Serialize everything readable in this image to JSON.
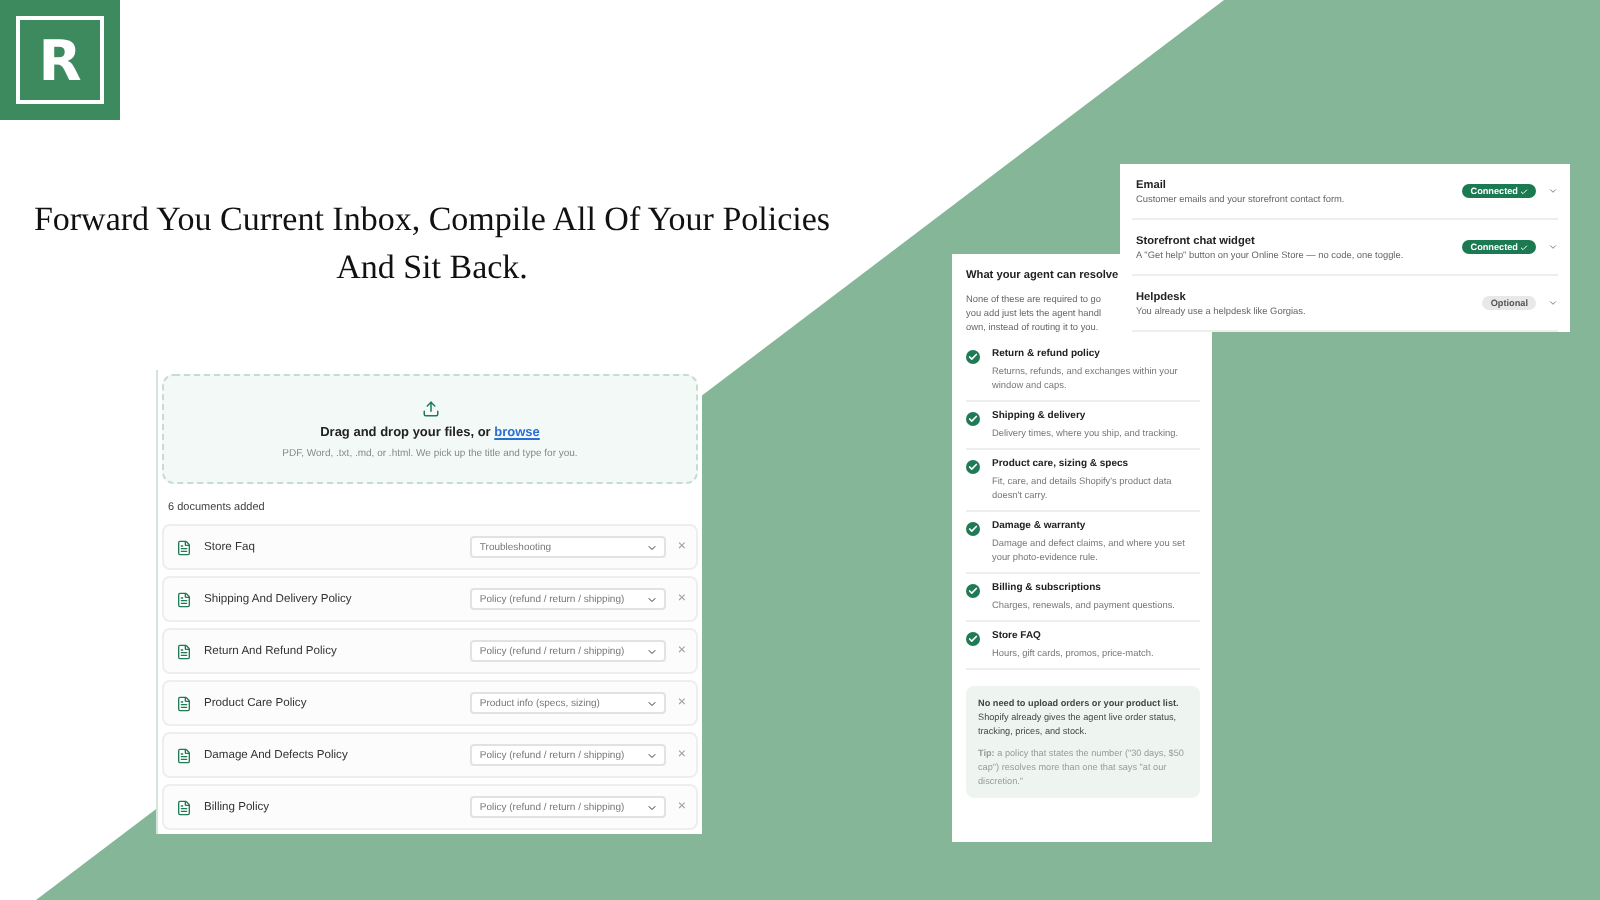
{
  "logo": {
    "letter": "R"
  },
  "headline": [
    "Forward You Current Inbox, Compile All Of Your Policies",
    "And Sit Back."
  ],
  "upload": {
    "title": "Drag and drop your files, or ",
    "link": "browse",
    "hint": "PDF, Word, .txt, .md, or .html. We pick up the title and type for you.",
    "count": "6 documents added",
    "documents": [
      {
        "name": "Store Faq",
        "category": "Troubleshooting",
        "remove": "×"
      },
      {
        "name": "Shipping And Delivery Policy",
        "category": "Policy (refund / return / shipping)",
        "remove": "×"
      },
      {
        "name": "Return And Refund Policy",
        "category": "Policy (refund / return / shipping)",
        "remove": "×"
      },
      {
        "name": "Product Care Policy",
        "category": "Product info (specs, sizing)",
        "remove": "×"
      },
      {
        "name": "Damage And Defects Policy",
        "category": "Policy (refund / return / shipping)",
        "remove": "×"
      },
      {
        "name": "Billing Policy",
        "category": "Policy (refund / return / shipping)",
        "remove": "×"
      }
    ]
  },
  "agent": {
    "title": "What your agent can resolve",
    "intro": [
      "None of these are required to go",
      "you add just lets the agent handl",
      "own, instead of routing it to you."
    ],
    "items": [
      {
        "title": "Return & refund policy",
        "description": "Returns, refunds, and exchanges within your window and caps.",
        "checked": true
      },
      {
        "title": "Shipping & delivery",
        "description": "Delivery times, where you ship, and tracking.",
        "checked": true
      },
      {
        "title": "Product care, sizing & specs",
        "description": "Fit, care, and details Shopify's product data doesn't carry.",
        "checked": true
      },
      {
        "title": "Damage & warranty",
        "description": "Damage and defect claims, and where you set your photo-evidence rule.",
        "checked": true
      },
      {
        "title": "Billing & subscriptions",
        "description": "Charges, renewals, and payment questions.",
        "checked": true
      },
      {
        "title": "Store FAQ",
        "description": "Hours, gift cards, promos, price-match.",
        "checked": true
      }
    ],
    "note": "**No need to upload orders or your product list.** Shopify already gives the agent live order status, tracking, prices, and stock.",
    "tip": "**Tip:** a policy that states the number (\"30 days, $50 cap\") resolves more than one that says \"at our discretion.\""
  },
  "channels": [
    {
      "name": "Email",
      "description": "Customer emails and your storefront contact form.",
      "connected": true,
      "badge": "Connected"
    },
    {
      "name": "Storefront chat widget",
      "description": "A \"Get help\" button on your Online Store — no code, one toggle.",
      "connected": true,
      "badge": "Connected"
    },
    {
      "name": "Helpdesk",
      "description": "You already use a helpdesk like Gorgias.",
      "connected": false,
      "badge": "Optional"
    }
  ]
}
